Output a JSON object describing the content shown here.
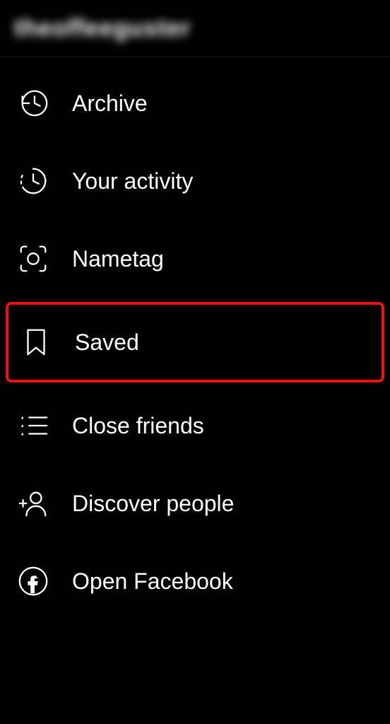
{
  "header": {
    "username": "theoffeeguster"
  },
  "menu": {
    "items": [
      {
        "label": "Archive",
        "icon": "archive-history-icon",
        "highlighted": false
      },
      {
        "label": "Your activity",
        "icon": "activity-clock-icon",
        "highlighted": false
      },
      {
        "label": "Nametag",
        "icon": "nametag-scan-icon",
        "highlighted": false
      },
      {
        "label": "Saved",
        "icon": "bookmark-icon",
        "highlighted": true
      },
      {
        "label": "Close friends",
        "icon": "star-list-icon",
        "highlighted": false
      },
      {
        "label": "Discover people",
        "icon": "add-person-icon",
        "highlighted": false
      },
      {
        "label": "Open Facebook",
        "icon": "facebook-icon",
        "highlighted": false
      }
    ]
  }
}
